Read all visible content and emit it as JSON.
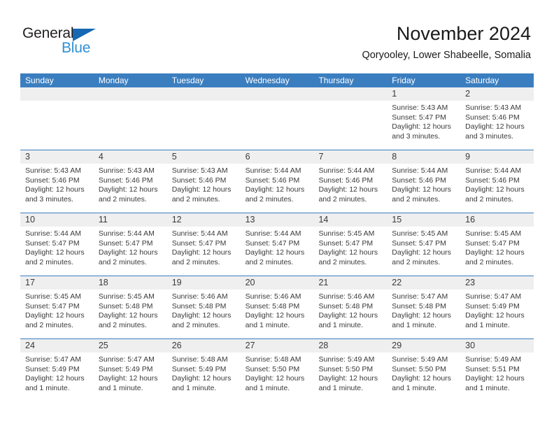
{
  "brand": {
    "name_part1": "General",
    "name_part2": "Blue",
    "triangle_icon": "blue-triangle-logo-mark",
    "color_dark": "#231f20",
    "color_blue": "#2f8fd4",
    "triangle_color": "#1668b3"
  },
  "header": {
    "title": "November 2024",
    "subtitle": "Qoryooley, Lower Shabeelle, Somalia",
    "accent_color": "#3b7ec0",
    "strip_color": "#efefef"
  },
  "weekdays": [
    "Sunday",
    "Monday",
    "Tuesday",
    "Wednesday",
    "Thursday",
    "Friday",
    "Saturday"
  ],
  "weeks": [
    [
      {
        "day": "",
        "empty": true,
        "sunrise": "",
        "sunset": "",
        "daylight1": "",
        "daylight2": ""
      },
      {
        "day": "",
        "empty": true,
        "sunrise": "",
        "sunset": "",
        "daylight1": "",
        "daylight2": ""
      },
      {
        "day": "",
        "empty": true,
        "sunrise": "",
        "sunset": "",
        "daylight1": "",
        "daylight2": ""
      },
      {
        "day": "",
        "empty": true,
        "sunrise": "",
        "sunset": "",
        "daylight1": "",
        "daylight2": ""
      },
      {
        "day": "",
        "empty": true,
        "sunrise": "",
        "sunset": "",
        "daylight1": "",
        "daylight2": ""
      },
      {
        "day": "1",
        "empty": false,
        "sunrise": "Sunrise: 5:43 AM",
        "sunset": "Sunset: 5:47 PM",
        "daylight1": "Daylight: 12 hours",
        "daylight2": "and 3 minutes."
      },
      {
        "day": "2",
        "empty": false,
        "sunrise": "Sunrise: 5:43 AM",
        "sunset": "Sunset: 5:46 PM",
        "daylight1": "Daylight: 12 hours",
        "daylight2": "and 3 minutes."
      }
    ],
    [
      {
        "day": "3",
        "empty": false,
        "sunrise": "Sunrise: 5:43 AM",
        "sunset": "Sunset: 5:46 PM",
        "daylight1": "Daylight: 12 hours",
        "daylight2": "and 3 minutes."
      },
      {
        "day": "4",
        "empty": false,
        "sunrise": "Sunrise: 5:43 AM",
        "sunset": "Sunset: 5:46 PM",
        "daylight1": "Daylight: 12 hours",
        "daylight2": "and 2 minutes."
      },
      {
        "day": "5",
        "empty": false,
        "sunrise": "Sunrise: 5:43 AM",
        "sunset": "Sunset: 5:46 PM",
        "daylight1": "Daylight: 12 hours",
        "daylight2": "and 2 minutes."
      },
      {
        "day": "6",
        "empty": false,
        "sunrise": "Sunrise: 5:44 AM",
        "sunset": "Sunset: 5:46 PM",
        "daylight1": "Daylight: 12 hours",
        "daylight2": "and 2 minutes."
      },
      {
        "day": "7",
        "empty": false,
        "sunrise": "Sunrise: 5:44 AM",
        "sunset": "Sunset: 5:46 PM",
        "daylight1": "Daylight: 12 hours",
        "daylight2": "and 2 minutes."
      },
      {
        "day": "8",
        "empty": false,
        "sunrise": "Sunrise: 5:44 AM",
        "sunset": "Sunset: 5:46 PM",
        "daylight1": "Daylight: 12 hours",
        "daylight2": "and 2 minutes."
      },
      {
        "day": "9",
        "empty": false,
        "sunrise": "Sunrise: 5:44 AM",
        "sunset": "Sunset: 5:46 PM",
        "daylight1": "Daylight: 12 hours",
        "daylight2": "and 2 minutes."
      }
    ],
    [
      {
        "day": "10",
        "empty": false,
        "sunrise": "Sunrise: 5:44 AM",
        "sunset": "Sunset: 5:47 PM",
        "daylight1": "Daylight: 12 hours",
        "daylight2": "and 2 minutes."
      },
      {
        "day": "11",
        "empty": false,
        "sunrise": "Sunrise: 5:44 AM",
        "sunset": "Sunset: 5:47 PM",
        "daylight1": "Daylight: 12 hours",
        "daylight2": "and 2 minutes."
      },
      {
        "day": "12",
        "empty": false,
        "sunrise": "Sunrise: 5:44 AM",
        "sunset": "Sunset: 5:47 PM",
        "daylight1": "Daylight: 12 hours",
        "daylight2": "and 2 minutes."
      },
      {
        "day": "13",
        "empty": false,
        "sunrise": "Sunrise: 5:44 AM",
        "sunset": "Sunset: 5:47 PM",
        "daylight1": "Daylight: 12 hours",
        "daylight2": "and 2 minutes."
      },
      {
        "day": "14",
        "empty": false,
        "sunrise": "Sunrise: 5:45 AM",
        "sunset": "Sunset: 5:47 PM",
        "daylight1": "Daylight: 12 hours",
        "daylight2": "and 2 minutes."
      },
      {
        "day": "15",
        "empty": false,
        "sunrise": "Sunrise: 5:45 AM",
        "sunset": "Sunset: 5:47 PM",
        "daylight1": "Daylight: 12 hours",
        "daylight2": "and 2 minutes."
      },
      {
        "day": "16",
        "empty": false,
        "sunrise": "Sunrise: 5:45 AM",
        "sunset": "Sunset: 5:47 PM",
        "daylight1": "Daylight: 12 hours",
        "daylight2": "and 2 minutes."
      }
    ],
    [
      {
        "day": "17",
        "empty": false,
        "sunrise": "Sunrise: 5:45 AM",
        "sunset": "Sunset: 5:47 PM",
        "daylight1": "Daylight: 12 hours",
        "daylight2": "and 2 minutes."
      },
      {
        "day": "18",
        "empty": false,
        "sunrise": "Sunrise: 5:45 AM",
        "sunset": "Sunset: 5:48 PM",
        "daylight1": "Daylight: 12 hours",
        "daylight2": "and 2 minutes."
      },
      {
        "day": "19",
        "empty": false,
        "sunrise": "Sunrise: 5:46 AM",
        "sunset": "Sunset: 5:48 PM",
        "daylight1": "Daylight: 12 hours",
        "daylight2": "and 2 minutes."
      },
      {
        "day": "20",
        "empty": false,
        "sunrise": "Sunrise: 5:46 AM",
        "sunset": "Sunset: 5:48 PM",
        "daylight1": "Daylight: 12 hours",
        "daylight2": "and 1 minute."
      },
      {
        "day": "21",
        "empty": false,
        "sunrise": "Sunrise: 5:46 AM",
        "sunset": "Sunset: 5:48 PM",
        "daylight1": "Daylight: 12 hours",
        "daylight2": "and 1 minute."
      },
      {
        "day": "22",
        "empty": false,
        "sunrise": "Sunrise: 5:47 AM",
        "sunset": "Sunset: 5:48 PM",
        "daylight1": "Daylight: 12 hours",
        "daylight2": "and 1 minute."
      },
      {
        "day": "23",
        "empty": false,
        "sunrise": "Sunrise: 5:47 AM",
        "sunset": "Sunset: 5:49 PM",
        "daylight1": "Daylight: 12 hours",
        "daylight2": "and 1 minute."
      }
    ],
    [
      {
        "day": "24",
        "empty": false,
        "sunrise": "Sunrise: 5:47 AM",
        "sunset": "Sunset: 5:49 PM",
        "daylight1": "Daylight: 12 hours",
        "daylight2": "and 1 minute."
      },
      {
        "day": "25",
        "empty": false,
        "sunrise": "Sunrise: 5:47 AM",
        "sunset": "Sunset: 5:49 PM",
        "daylight1": "Daylight: 12 hours",
        "daylight2": "and 1 minute."
      },
      {
        "day": "26",
        "empty": false,
        "sunrise": "Sunrise: 5:48 AM",
        "sunset": "Sunset: 5:49 PM",
        "daylight1": "Daylight: 12 hours",
        "daylight2": "and 1 minute."
      },
      {
        "day": "27",
        "empty": false,
        "sunrise": "Sunrise: 5:48 AM",
        "sunset": "Sunset: 5:50 PM",
        "daylight1": "Daylight: 12 hours",
        "daylight2": "and 1 minute."
      },
      {
        "day": "28",
        "empty": false,
        "sunrise": "Sunrise: 5:49 AM",
        "sunset": "Sunset: 5:50 PM",
        "daylight1": "Daylight: 12 hours",
        "daylight2": "and 1 minute."
      },
      {
        "day": "29",
        "empty": false,
        "sunrise": "Sunrise: 5:49 AM",
        "sunset": "Sunset: 5:50 PM",
        "daylight1": "Daylight: 12 hours",
        "daylight2": "and 1 minute."
      },
      {
        "day": "30",
        "empty": false,
        "sunrise": "Sunrise: 5:49 AM",
        "sunset": "Sunset: 5:51 PM",
        "daylight1": "Daylight: 12 hours",
        "daylight2": "and 1 minute."
      }
    ]
  ]
}
